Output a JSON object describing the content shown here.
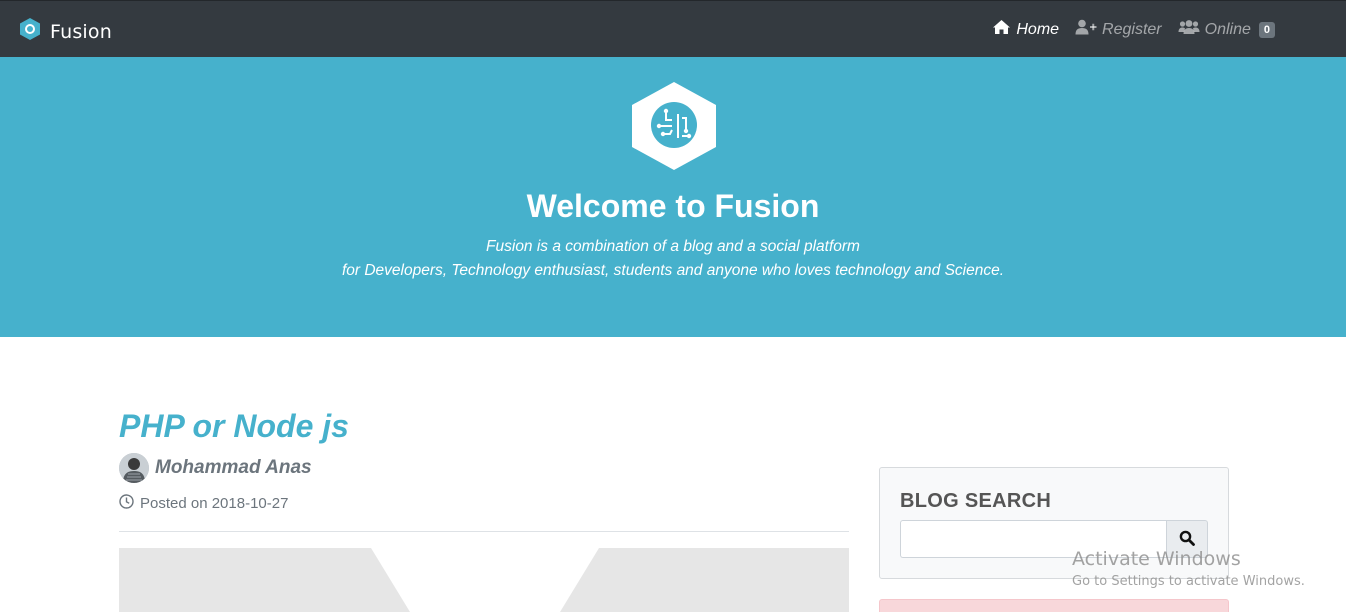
{
  "navbar": {
    "brand": "Fusion",
    "links": {
      "home": "Home",
      "register": "Register",
      "online": "Online",
      "online_count": "0"
    }
  },
  "hero": {
    "title": "Welcome to Fusion",
    "subtitle_line1": "Fusion is a combination of a blog and a social platform",
    "subtitle_line2": "for Developers, Technology enthusiast, students and anyone who loves technology and Science."
  },
  "post": {
    "title": "PHP or Node js",
    "author": "Mohammad Anas",
    "posted": "Posted on 2018-10-27"
  },
  "sidebar": {
    "search_heading": "BLOG SEARCH",
    "search_value": ""
  },
  "watermark": {
    "title": "Activate Windows",
    "subtitle": "Go to Settings to activate Windows."
  },
  "colors": {
    "navbar": "#343a40",
    "hero": "#46b1cc",
    "accent": "#46b1cc"
  },
  "icons": [
    "fusion-logo-icon",
    "home-icon",
    "user-plus-icon",
    "users-icon",
    "circuit-logo-icon",
    "clock-icon",
    "search-icon"
  ]
}
